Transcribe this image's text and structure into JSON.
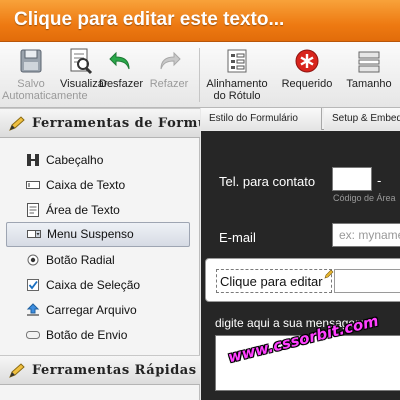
{
  "title": "Clique para editar este texto...",
  "toolbar": {
    "items": [
      {
        "label1": "Salvo",
        "label2": "Automaticamente",
        "icon": "floppy-disk-icon"
      },
      {
        "label1": "Visualizar",
        "label2": "",
        "icon": "preview-icon"
      },
      {
        "label1": "Desfazer",
        "label2": "",
        "icon": "undo-icon"
      },
      {
        "label1": "Refazer",
        "label2": "",
        "icon": "redo-icon"
      },
      {
        "label1": "Alinhamento",
        "label2": "do Rótulo",
        "icon": "label-align-icon"
      },
      {
        "label1": "Requerido",
        "label2": "",
        "icon": "required-icon"
      },
      {
        "label1": "Tamanho",
        "label2": "",
        "icon": "resize-icon"
      }
    ]
  },
  "left_panel": {
    "header": "Ferramentas de Formulário",
    "tools": [
      {
        "label": "Cabeçalho",
        "icon": "heading-icon"
      },
      {
        "label": "Caixa de Texto",
        "icon": "textbox-icon"
      },
      {
        "label": "Área de Texto",
        "icon": "textarea-icon"
      },
      {
        "label": "Menu Suspenso",
        "icon": "dropdown-icon"
      },
      {
        "label": "Botão Radial",
        "icon": "radio-icon"
      },
      {
        "label": "Caixa de Seleção",
        "icon": "checkbox-icon"
      },
      {
        "label": "Carregar Arquivo",
        "icon": "upload-icon"
      },
      {
        "label": "Botão de Envio",
        "icon": "submit-button-icon"
      }
    ],
    "quick_header": "Ferramentas Rápidas"
  },
  "tabs": [
    {
      "label": "Estilo do Formulário"
    },
    {
      "label": "Setup & Embed"
    }
  ],
  "form": {
    "phone_label": "Tel. para contato",
    "phone_dash": "-",
    "phone_sublabel": "Código de Área",
    "email_label": "E-mail",
    "email_placeholder": "ex: myname@example.com",
    "edit_label": "Clique para editar",
    "message_label": "digite aqui a sua mensagem !"
  },
  "watermark": "www.cssorbit.com",
  "colors": {
    "title_bar": "#ee7a12",
    "form_bg": "#262626",
    "watermark": "#ff40ff"
  }
}
